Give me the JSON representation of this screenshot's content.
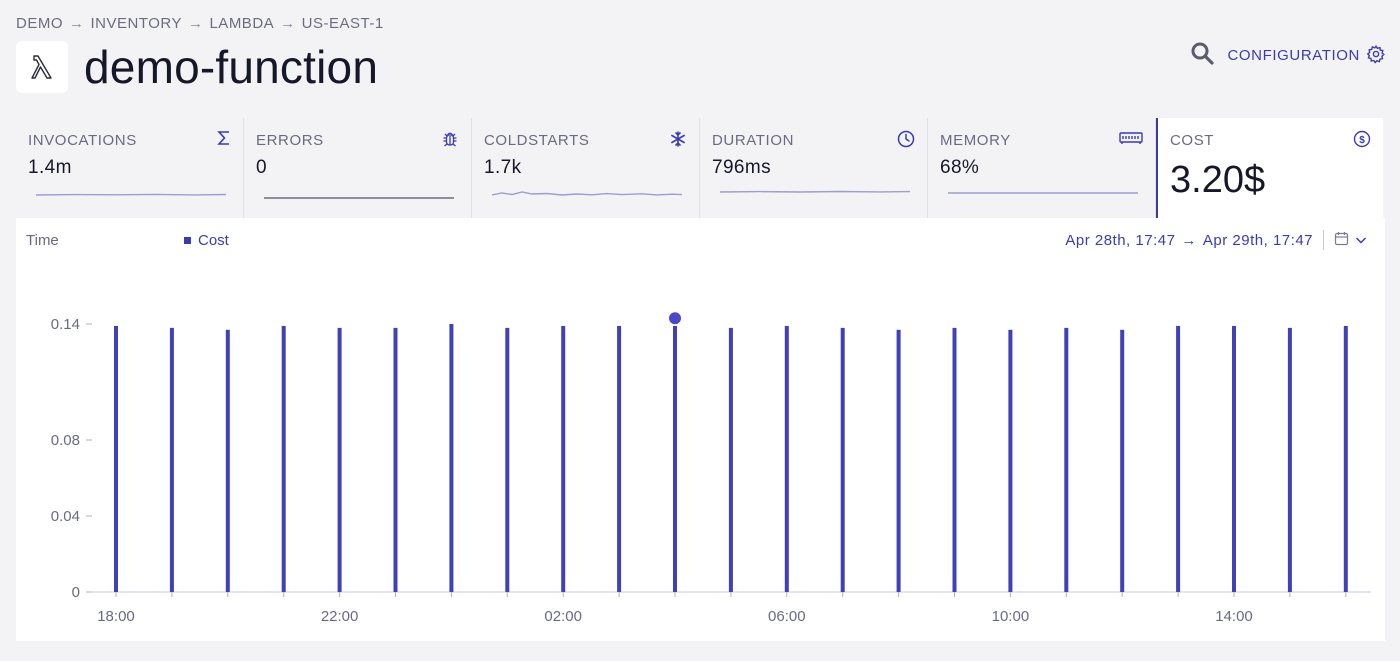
{
  "breadcrumb": [
    "DEMO",
    "INVENTORY",
    "LAMBDA",
    "US-EAST-1"
  ],
  "breadcrumb_separator": "→",
  "page": {
    "title": "demo-function",
    "icon": "lambda-icon"
  },
  "header": {
    "search_icon": "search-icon",
    "config_label": "CONFIGURATION",
    "config_icon": "gear-icon"
  },
  "metrics": [
    {
      "label": "INVOCATIONS",
      "value": "1.4m",
      "icon": "sigma-icon"
    },
    {
      "label": "ERRORS",
      "value": "0",
      "icon": "bug-icon"
    },
    {
      "label": "COLDSTARTS",
      "value": "1.7k",
      "icon": "snowflake-icon"
    },
    {
      "label": "DURATION",
      "value": "796ms",
      "icon": "clock-icon"
    },
    {
      "label": "MEMORY",
      "value": "68%",
      "icon": "memory-icon"
    },
    {
      "label": "COST",
      "value": "3.20$",
      "icon": "dollar-icon",
      "selected": true
    }
  ],
  "chart_header": {
    "time_label": "Time",
    "legend_label": "Cost",
    "range_start": "Apr 28th, 17:47",
    "range_arrow": "→",
    "range_end": "Apr 29th, 17:47",
    "calendar_icon": "calendar-icon",
    "chevron_icon": "chevron-down-icon"
  },
  "colors": {
    "accent": "#3b3bb0",
    "bar": "#4040b8"
  },
  "chart_data": {
    "type": "bar",
    "series": [
      {
        "name": "Cost",
        "x": [
          "18:00",
          "19:00",
          "20:00",
          "21:00",
          "22:00",
          "23:00",
          "00:00",
          "01:00",
          "02:00",
          "03:00",
          "04:00",
          "05:00",
          "06:00",
          "07:00",
          "08:00",
          "09:00",
          "10:00",
          "11:00",
          "12:00",
          "13:00",
          "14:00",
          "15:00",
          "16:00"
        ],
        "values": [
          0.139,
          0.138,
          0.137,
          0.139,
          0.138,
          0.138,
          0.14,
          0.138,
          0.139,
          0.139,
          0.139,
          0.138,
          0.139,
          0.138,
          0.137,
          0.138,
          0.137,
          0.138,
          0.137,
          0.139,
          0.139,
          0.138,
          0.139
        ]
      }
    ],
    "highlight_index": 10,
    "highlight_value": 0.143,
    "x_tick_labels": [
      "18:00",
      "22:00",
      "02:00",
      "06:00",
      "10:00",
      "14:00"
    ],
    "x_tick_indices": [
      0,
      4,
      8,
      12,
      16,
      20
    ],
    "y_ticks": [
      0,
      0.04,
      0.08,
      0.14
    ],
    "y_tick_labels": [
      "0",
      "0.04",
      "0.08",
      "0.14"
    ],
    "ylim": [
      0,
      0.14
    ],
    "grid": false
  }
}
